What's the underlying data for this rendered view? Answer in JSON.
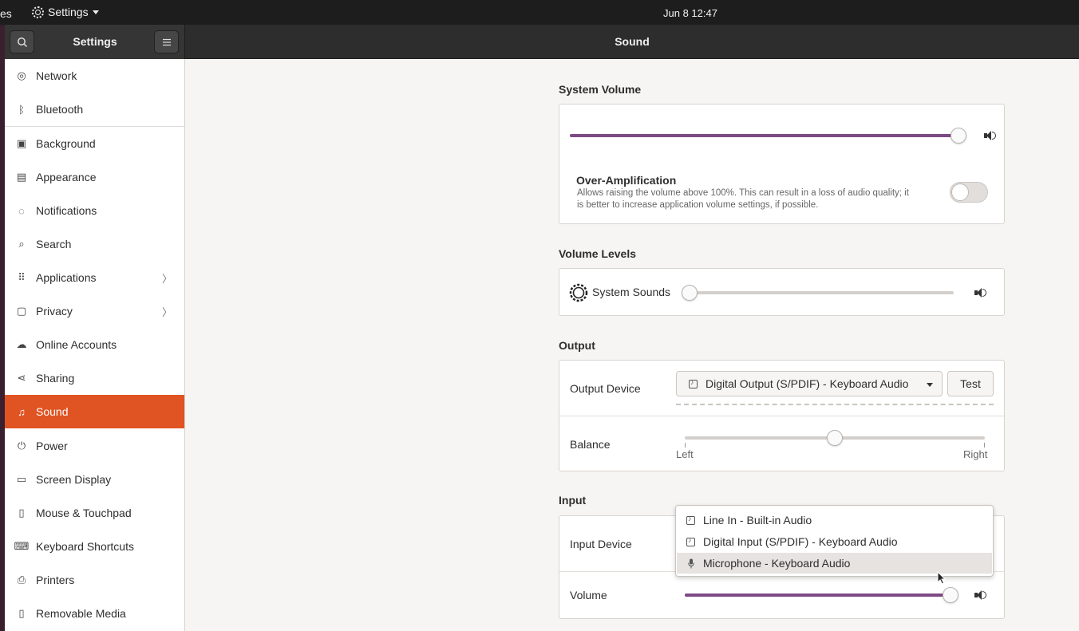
{
  "topbar": {
    "activities": "es",
    "app_menu": "Settings",
    "clock": "Jun 8  12:47"
  },
  "header": {
    "sidebar_title": "Settings",
    "page_title": "Sound"
  },
  "sidebar": {
    "items": [
      {
        "label": "Network",
        "icon": "network-icon"
      },
      {
        "label": "Bluetooth",
        "icon": "bluetooth-icon"
      },
      {
        "label": "Background",
        "icon": "background-icon"
      },
      {
        "label": "Appearance",
        "icon": "appearance-icon"
      },
      {
        "label": "Notifications",
        "icon": "bell-icon"
      },
      {
        "label": "Search",
        "icon": "search-icon"
      },
      {
        "label": "Applications",
        "icon": "grid-icon",
        "chevron": true
      },
      {
        "label": "Privacy",
        "icon": "lock-icon",
        "chevron": true
      },
      {
        "label": "Online Accounts",
        "icon": "cloud-icon"
      },
      {
        "label": "Sharing",
        "icon": "share-icon"
      },
      {
        "label": "Sound",
        "icon": "music-note-icon",
        "active": true
      },
      {
        "label": "Power",
        "icon": "power-icon"
      },
      {
        "label": "Screen Display",
        "icon": "display-icon"
      },
      {
        "label": "Mouse & Touchpad",
        "icon": "mouse-icon"
      },
      {
        "label": "Keyboard Shortcuts",
        "icon": "keyboard-icon"
      },
      {
        "label": "Printers",
        "icon": "printer-icon"
      },
      {
        "label": "Removable Media",
        "icon": "media-icon"
      }
    ]
  },
  "system_volume": {
    "title": "System Volume",
    "level": 0.99,
    "over_amp_title": "Over-Amplification",
    "over_amp_desc_line1": "Allows raising the volume above 100%. This can result in a loss of audio quality; it",
    "over_amp_desc_line2": "is better to increase application volume settings, if possible.",
    "over_amp_on": false
  },
  "volume_levels": {
    "title": "Volume Levels",
    "system_sounds_label": "System Sounds",
    "system_sounds_level": 0.0
  },
  "output": {
    "title": "Output",
    "device_label": "Output Device",
    "device_value": "Digital Output (S/PDIF) - Keyboard Audio",
    "test_label": "Test",
    "balance_label": "Balance",
    "balance_value": 0.5,
    "left_label": "Left",
    "right_label": "Right"
  },
  "input": {
    "title": "Input",
    "device_label": "Input Device",
    "volume_label": "Volume",
    "volume_level": 0.99,
    "options": [
      {
        "label": "Line In - Built-in Audio",
        "icon": "music-note-icon"
      },
      {
        "label": "Digital Input (S/PDIF) - Keyboard Audio",
        "icon": "music-note-icon"
      },
      {
        "label": "Microphone - Keyboard Audio",
        "icon": "microphone-icon",
        "highlighted": true
      }
    ]
  }
}
